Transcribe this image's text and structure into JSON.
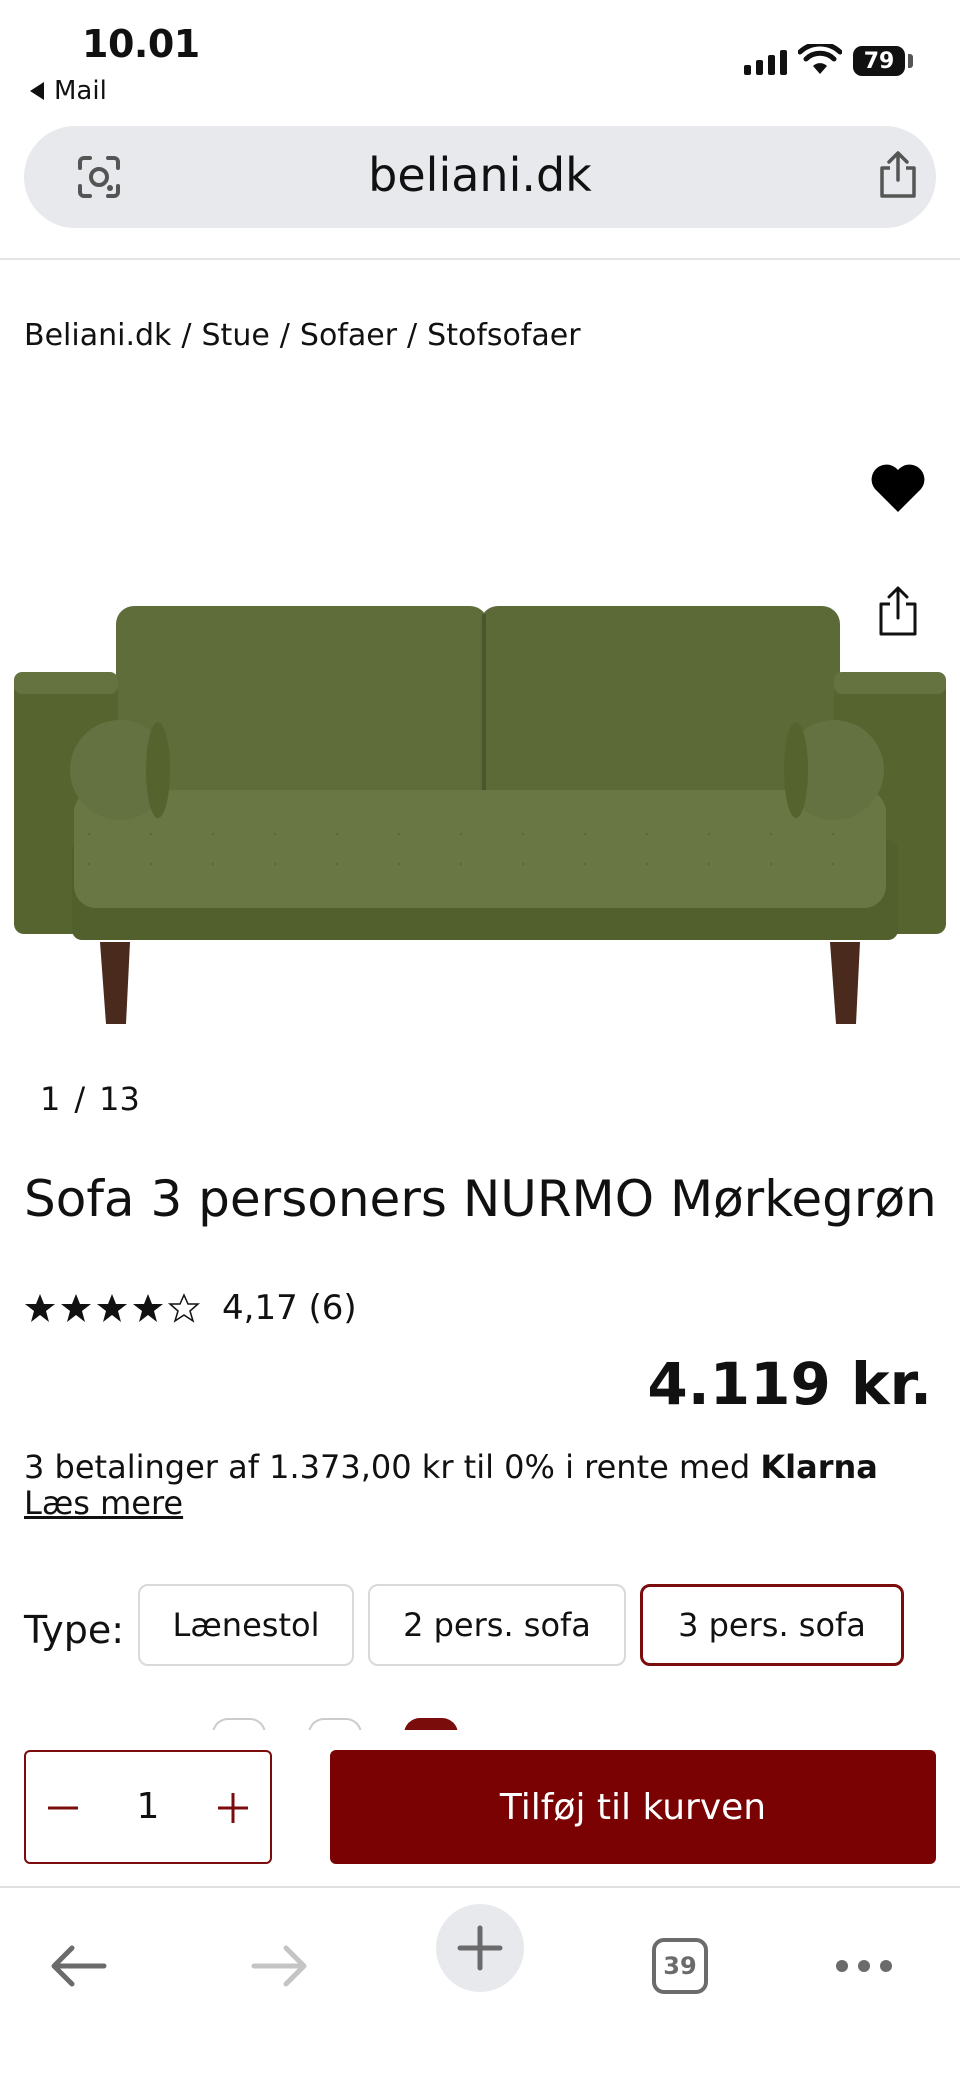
{
  "status_bar": {
    "time": "10.01",
    "back_app": "Mail",
    "battery": "79"
  },
  "browser": {
    "url": "beliani.dk",
    "tabs_count": "39"
  },
  "breadcrumb": [
    "Beliani.dk",
    "Stue",
    "Sofaer",
    "Stofsofaer"
  ],
  "product": {
    "image_index": "1",
    "image_total": "13",
    "title": "Sofa 3 personers NURMO Mørkegrøn",
    "rating_value": 4.17,
    "rating_text": "4,17 (6)",
    "price": "4.119 kr.",
    "klarna_text": "3 betalinger af 1.373,00 kr til 0% i rente med ",
    "klarna_brand": "Klarna",
    "read_more": "Læs mere",
    "sofa_color": "#5d6b3a"
  },
  "type_selector": {
    "label": "Type:",
    "options": [
      "Lænestol",
      "2 pers. sofa",
      "3 pers. sofa"
    ],
    "selected": "3 pers. sofa"
  },
  "cart": {
    "quantity": "1",
    "add_label": "Tilføj til kurven",
    "accent_color": "#7a0202"
  },
  "icons": {
    "lens": "lens-icon",
    "share": "share-icon",
    "favorite": "heart-icon",
    "back": "arrow-left-icon",
    "forward": "arrow-right-icon",
    "new_tab": "plus-icon",
    "more": "more-icon"
  }
}
